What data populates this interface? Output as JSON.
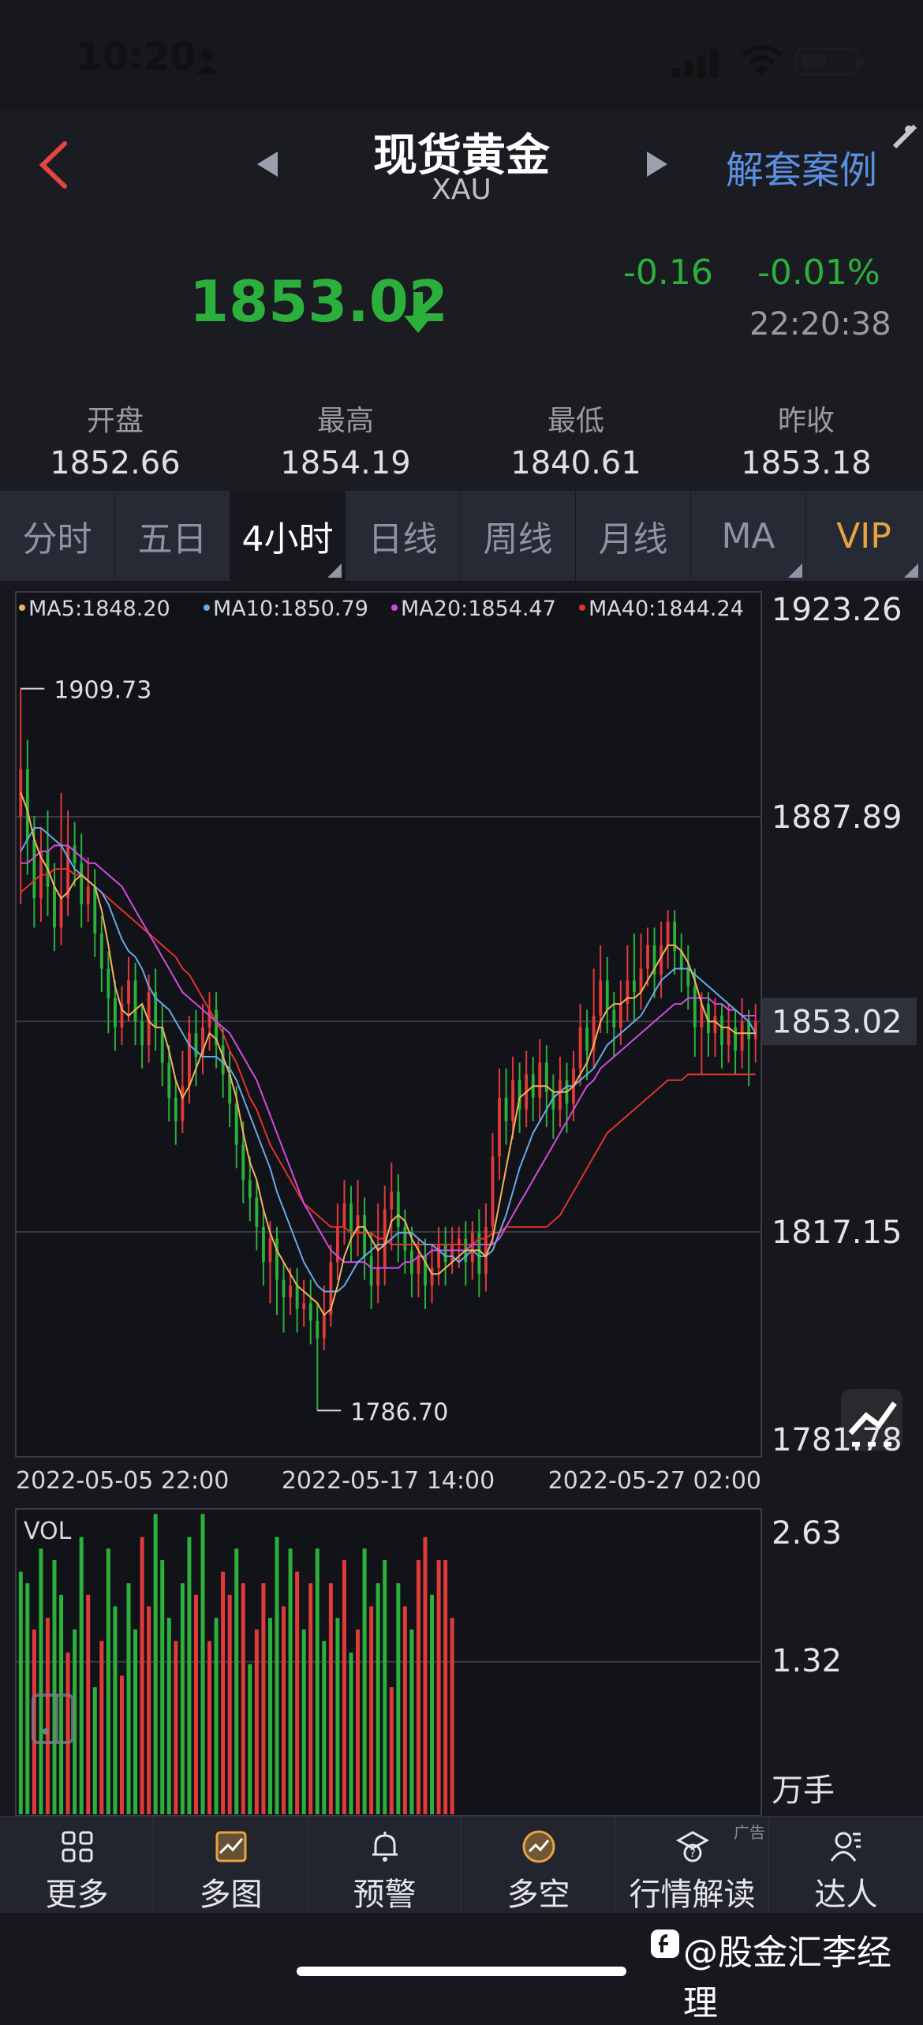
{
  "status": {
    "time": "10:20"
  },
  "header": {
    "title": "现货黄金",
    "subtitle": "XAU",
    "case_link": "解套案例"
  },
  "quote": {
    "price": "1853.02",
    "change": "-0.16",
    "change_pct": "-0.01%",
    "time": "22:20:38"
  },
  "stats": [
    {
      "label": "开盘",
      "value": "1852.66"
    },
    {
      "label": "最高",
      "value": "1854.19"
    },
    {
      "label": "最低",
      "value": "1840.61"
    },
    {
      "label": "昨收",
      "value": "1853.18"
    }
  ],
  "tabs": [
    "分时",
    "五日",
    "4小时",
    "日线",
    "周线",
    "月线",
    "MA",
    "VIP"
  ],
  "active_tab": "4小时",
  "colors": {
    "up": "#e03a3a",
    "down": "#2bb03c",
    "ma5": "#f0b35a",
    "ma10": "#69a9e6",
    "ma20": "#d24be0",
    "ma40": "#e0342a",
    "accent": "#5b8fe0",
    "vip": "#e8a341"
  },
  "chart_data": [
    {
      "type": "candlestick",
      "legend": [
        "MA5:1848.20",
        "MA10:1850.79",
        "MA20:1854.47",
        "MA40:1844.24"
      ],
      "y_labels": [
        "1923.26",
        "1887.89",
        "1853.02",
        "1817.15",
        "1781.78"
      ],
      "ylim": [
        1781.78,
        1923.26
      ],
      "current_price": "1853.02",
      "high_annotation": "1909.73",
      "low_annotation": "1786.70",
      "x_labels": [
        "2022-05-05 22:00",
        "2022-05-17 14:00",
        "2022-05-27 02:00"
      ],
      "candles": [
        [
          1888,
          1896,
          1873,
          1909.73
        ],
        [
          1896,
          1884,
          1878,
          1901
        ],
        [
          1884,
          1874,
          1869,
          1888
        ],
        [
          1874,
          1882,
          1870,
          1886
        ],
        [
          1882,
          1876,
          1871,
          1889
        ],
        [
          1876,
          1869,
          1865,
          1880
        ],
        [
          1869,
          1874,
          1866,
          1892
        ],
        [
          1874,
          1883,
          1871,
          1889
        ],
        [
          1883,
          1880,
          1876,
          1887
        ],
        [
          1880,
          1873,
          1869,
          1885
        ],
        [
          1873,
          1876,
          1870,
          1881
        ],
        [
          1876,
          1868,
          1864,
          1879
        ],
        [
          1868,
          1862,
          1858,
          1871
        ],
        [
          1862,
          1857,
          1851,
          1865
        ],
        [
          1857,
          1852,
          1848,
          1860
        ],
        [
          1852,
          1856,
          1849,
          1859
        ],
        [
          1856,
          1860,
          1853,
          1864
        ],
        [
          1860,
          1853,
          1849,
          1863
        ],
        [
          1853,
          1849,
          1845,
          1856
        ],
        [
          1849,
          1858,
          1846,
          1861
        ],
        [
          1858,
          1852,
          1848,
          1862
        ],
        [
          1852,
          1846,
          1842,
          1856
        ],
        [
          1846,
          1840,
          1836,
          1849
        ],
        [
          1840,
          1836,
          1832,
          1843
        ],
        [
          1836,
          1842,
          1834,
          1848
        ],
        [
          1842,
          1851,
          1839,
          1854
        ],
        [
          1851,
          1847,
          1842,
          1855
        ],
        [
          1847,
          1852,
          1844,
          1856
        ],
        [
          1852,
          1855,
          1848,
          1858
        ],
        [
          1855,
          1849,
          1845,
          1858
        ],
        [
          1849,
          1844,
          1840,
          1852
        ],
        [
          1844,
          1839,
          1835,
          1848
        ],
        [
          1839,
          1832,
          1828,
          1842
        ],
        [
          1832,
          1826,
          1822,
          1836
        ],
        [
          1826,
          1823,
          1819,
          1830
        ],
        [
          1823,
          1818,
          1814,
          1826
        ],
        [
          1818,
          1812,
          1808,
          1821
        ],
        [
          1812,
          1816,
          1805,
          1819
        ],
        [
          1816,
          1809,
          1803,
          1818
        ],
        [
          1809,
          1806,
          1800,
          1812
        ],
        [
          1806,
          1808,
          1803,
          1811
        ],
        [
          1808,
          1804,
          1800,
          1811
        ],
        [
          1804,
          1805,
          1801,
          1809
        ],
        [
          1805,
          1802,
          1798,
          1809
        ],
        [
          1802,
          1799,
          1786.7,
          1805
        ],
        [
          1799,
          1803,
          1797,
          1808
        ],
        [
          1803,
          1812,
          1801,
          1815
        ],
        [
          1812,
          1818,
          1809,
          1822
        ],
        [
          1818,
          1822,
          1815,
          1826
        ],
        [
          1822,
          1817,
          1812,
          1825
        ],
        [
          1817,
          1820,
          1813,
          1826
        ],
        [
          1820,
          1813,
          1809,
          1823
        ],
        [
          1813,
          1808,
          1804,
          1817
        ],
        [
          1808,
          1811,
          1805,
          1822
        ],
        [
          1811,
          1821,
          1808,
          1825
        ],
        [
          1821,
          1824,
          1814,
          1829
        ],
        [
          1824,
          1818,
          1812,
          1827
        ],
        [
          1818,
          1814,
          1810,
          1821
        ],
        [
          1814,
          1810,
          1806,
          1818
        ],
        [
          1810,
          1813,
          1806,
          1816
        ],
        [
          1813,
          1808,
          1804,
          1816
        ],
        [
          1808,
          1811,
          1805,
          1815
        ],
        [
          1811,
          1815,
          1808,
          1818
        ],
        [
          1815,
          1812,
          1808,
          1818
        ],
        [
          1812,
          1815,
          1810,
          1818
        ],
        [
          1815,
          1816,
          1811,
          1818
        ],
        [
          1816,
          1812,
          1808,
          1819
        ],
        [
          1812,
          1817,
          1809,
          1819
        ],
        [
          1817,
          1810,
          1806,
          1821
        ],
        [
          1810,
          1818,
          1807,
          1822
        ],
        [
          1818,
          1830,
          1815,
          1834
        ],
        [
          1830,
          1840,
          1826,
          1845
        ],
        [
          1840,
          1836,
          1832,
          1845
        ],
        [
          1836,
          1843,
          1833,
          1847
        ],
        [
          1843,
          1838,
          1834,
          1846
        ],
        [
          1838,
          1844,
          1835,
          1848
        ],
        [
          1844,
          1840,
          1836,
          1847
        ],
        [
          1840,
          1846,
          1836,
          1850
        ],
        [
          1846,
          1841,
          1835,
          1849
        ],
        [
          1841,
          1838,
          1833,
          1844
        ],
        [
          1838,
          1843,
          1835,
          1847
        ],
        [
          1843,
          1839,
          1834,
          1846
        ],
        [
          1839,
          1845,
          1836,
          1848
        ],
        [
          1845,
          1852,
          1842,
          1856
        ],
        [
          1852,
          1848,
          1843,
          1855
        ],
        [
          1848,
          1854,
          1845,
          1862
        ],
        [
          1854,
          1860,
          1851,
          1866
        ],
        [
          1860,
          1855,
          1851,
          1864
        ],
        [
          1855,
          1852,
          1847,
          1858
        ],
        [
          1852,
          1856,
          1849,
          1860
        ],
        [
          1856,
          1860,
          1853,
          1866
        ],
        [
          1860,
          1858,
          1853,
          1868
        ],
        [
          1858,
          1862,
          1855,
          1868
        ],
        [
          1862,
          1866,
          1859,
          1869
        ],
        [
          1866,
          1861,
          1857,
          1869
        ],
        [
          1861,
          1866,
          1857,
          1870
        ],
        [
          1866,
          1870,
          1862,
          1872
        ],
        [
          1870,
          1865,
          1861,
          1872
        ],
        [
          1865,
          1862,
          1858,
          1868
        ],
        [
          1862,
          1859,
          1855,
          1866
        ],
        [
          1859,
          1852,
          1847,
          1862
        ],
        [
          1852,
          1856,
          1844,
          1858
        ],
        [
          1856,
          1851,
          1847,
          1858
        ],
        [
          1851,
          1854,
          1847,
          1857
        ],
        [
          1854,
          1849,
          1845,
          1856
        ],
        [
          1849,
          1852,
          1846,
          1856
        ],
        [
          1852,
          1848,
          1844,
          1855
        ],
        [
          1848,
          1853,
          1845,
          1857
        ],
        [
          1853,
          1850,
          1842,
          1855
        ],
        [
          1850,
          1853.02,
          1846,
          1856
        ]
      ],
      "ma5": [
        1892,
        1889,
        1884,
        1881,
        1879,
        1876,
        1874,
        1875,
        1877,
        1878,
        1877,
        1876,
        1872,
        1866,
        1859,
        1855,
        1854,
        1855,
        1856,
        1853,
        1852,
        1852,
        1848,
        1843,
        1840,
        1842,
        1845,
        1848,
        1851,
        1850,
        1847,
        1844,
        1840,
        1834,
        1829,
        1826,
        1821,
        1817,
        1814,
        1812,
        1810,
        1808,
        1807,
        1806,
        1805,
        1803,
        1804,
        1808,
        1813,
        1816,
        1818,
        1818,
        1816,
        1814,
        1815,
        1819,
        1820,
        1819,
        1816,
        1814,
        1812,
        1810,
        1810,
        1811,
        1812,
        1813,
        1814,
        1814,
        1814,
        1813,
        1816,
        1822,
        1828,
        1834,
        1840,
        1841,
        1842,
        1842,
        1842,
        1841,
        1841,
        1841,
        1842,
        1844,
        1846,
        1849,
        1853,
        1855,
        1856,
        1856,
        1857,
        1857,
        1858,
        1860,
        1862,
        1864,
        1866,
        1866,
        1865,
        1863,
        1860,
        1856,
        1853,
        1853,
        1852,
        1852,
        1851,
        1851,
        1851,
        1851
      ],
      "ma10": [
        1882,
        1884,
        1886,
        1886,
        1885,
        1884,
        1883,
        1881,
        1879,
        1878,
        1877,
        1876,
        1875,
        1873,
        1870,
        1867,
        1865,
        1864,
        1862,
        1859,
        1857,
        1856,
        1855,
        1853,
        1851,
        1849,
        1848,
        1847,
        1847,
        1847,
        1846,
        1845,
        1843,
        1840,
        1837,
        1834,
        1831,
        1828,
        1824,
        1821,
        1818,
        1815,
        1812,
        1810,
        1808,
        1807,
        1807,
        1807,
        1808,
        1810,
        1812,
        1813,
        1814,
        1815,
        1815,
        1816,
        1817,
        1817,
        1817,
        1816,
        1815,
        1815,
        1814,
        1813,
        1813,
        1812,
        1813,
        1814,
        1813,
        1813,
        1814,
        1817,
        1820,
        1824,
        1828,
        1831,
        1834,
        1836,
        1838,
        1840,
        1841,
        1842,
        1842,
        1843,
        1844,
        1845,
        1847,
        1849,
        1850,
        1851,
        1852,
        1853,
        1854,
        1856,
        1858,
        1860,
        1861,
        1862,
        1862,
        1862,
        1861,
        1860,
        1859,
        1858,
        1857,
        1856,
        1855,
        1854,
        1853,
        1851
      ],
      "ma20": [
        1880,
        1880,
        1881,
        1882,
        1882,
        1883,
        1883,
        1883,
        1882,
        1881,
        1880,
        1880,
        1879,
        1878,
        1877,
        1876,
        1874,
        1872,
        1870,
        1868,
        1866,
        1864,
        1862,
        1860,
        1858,
        1857,
        1856,
        1855,
        1854,
        1853,
        1852,
        1851,
        1849,
        1847,
        1845,
        1843,
        1840,
        1837,
        1834,
        1831,
        1828,
        1825,
        1822,
        1820,
        1818,
        1816,
        1814,
        1813,
        1812,
        1812,
        1812,
        1812,
        1811,
        1811,
        1811,
        1811,
        1811,
        1812,
        1812,
        1813,
        1813,
        1814,
        1814,
        1814,
        1814,
        1814,
        1814,
        1815,
        1815,
        1815,
        1815,
        1816,
        1818,
        1820,
        1822,
        1824,
        1826,
        1828,
        1830,
        1832,
        1834,
        1836,
        1838,
        1840,
        1842,
        1843,
        1845,
        1846,
        1847,
        1848,
        1849,
        1850,
        1851,
        1852,
        1853,
        1854,
        1855,
        1856,
        1856,
        1857,
        1857,
        1857,
        1857,
        1856,
        1856,
        1855,
        1855,
        1854,
        1854,
        1854
      ],
      "ma40": [
        1875,
        1876,
        1877,
        1878,
        1878,
        1879,
        1879,
        1879,
        1878,
        1878,
        1877,
        1876,
        1875,
        1874,
        1873,
        1872,
        1871,
        1870,
        1869,
        1868,
        1867,
        1866,
        1865,
        1864,
        1862,
        1861,
        1859,
        1857,
        1855,
        1853,
        1851,
        1848,
        1846,
        1843,
        1840,
        1838,
        1835,
        1832,
        1830,
        1828,
        1826,
        1824,
        1822,
        1821,
        1820,
        1819,
        1818,
        1818,
        1818,
        1817,
        1817,
        1817,
        1817,
        1816,
        1816,
        1815,
        1815,
        1815,
        1815,
        1815,
        1815,
        1815,
        1815,
        1815,
        1815,
        1815,
        1815,
        1815,
        1816,
        1816,
        1817,
        1817,
        1818,
        1818,
        1818,
        1818,
        1818,
        1818,
        1818,
        1819,
        1820,
        1822,
        1824,
        1826,
        1828,
        1830,
        1832,
        1834,
        1835,
        1836,
        1837,
        1838,
        1839,
        1840,
        1841,
        1842,
        1843,
        1843,
        1843,
        1844,
        1844,
        1844,
        1844,
        1844,
        1844,
        1844,
        1844,
        1844,
        1844,
        1844
      ]
    },
    {
      "type": "bar",
      "label": "VOL",
      "y_labels": [
        "2.63",
        "1.32",
        "万手"
      ],
      "ylim": [
        0,
        2.63
      ],
      "values": [
        2.1,
        2.0,
        1.6,
        2.3,
        1.7,
        2.2,
        1.9,
        1.4,
        1.6,
        2.4,
        1.9,
        1.1,
        1.5,
        2.3,
        1.8,
        1.2,
        2.0,
        1.6,
        2.4,
        1.8,
        2.6,
        2.2,
        1.7,
        1.5,
        2.0,
        2.4,
        1.9,
        2.6,
        1.5,
        1.7,
        2.1,
        1.9,
        2.3,
        2.0,
        1.3,
        1.6,
        2.0,
        1.7,
        2.4,
        1.8,
        2.3,
        2.1,
        1.6,
        2.0,
        2.3,
        1.5,
        2.0,
        1.7,
        2.2,
        1.4,
        1.6,
        2.3,
        1.8,
        2.0,
        2.2,
        1.1,
        2.0,
        1.8,
        1.6,
        2.2,
        2.4,
        1.9,
        2.2,
        2.2,
        1.7
      ],
      "up": [
        false,
        false,
        true,
        false,
        true,
        false,
        false,
        true,
        false,
        false,
        true,
        false,
        true,
        false,
        false,
        true,
        false,
        false,
        true,
        true,
        false,
        false,
        false,
        true,
        false,
        false,
        true,
        false,
        true,
        false,
        true,
        true,
        false,
        true,
        false,
        true,
        true,
        false,
        false,
        true,
        false,
        true,
        false,
        true,
        false,
        false,
        true,
        false,
        true,
        false,
        true,
        false,
        true,
        false,
        false,
        true,
        false,
        true,
        false,
        true,
        true,
        false,
        true,
        true,
        true
      ]
    }
  ],
  "nav": [
    {
      "label": "更多",
      "icon": "grid-icon"
    },
    {
      "label": "多图",
      "icon": "multi-chart-icon"
    },
    {
      "label": "预警",
      "icon": "bell-icon"
    },
    {
      "label": "多空",
      "icon": "bull-bear-icon"
    },
    {
      "label": "行情解读",
      "icon": "analysis-icon"
    },
    {
      "label": "达人",
      "icon": "expert-icon"
    }
  ],
  "ad_label": "广告",
  "watermark": "@股金汇李经理"
}
